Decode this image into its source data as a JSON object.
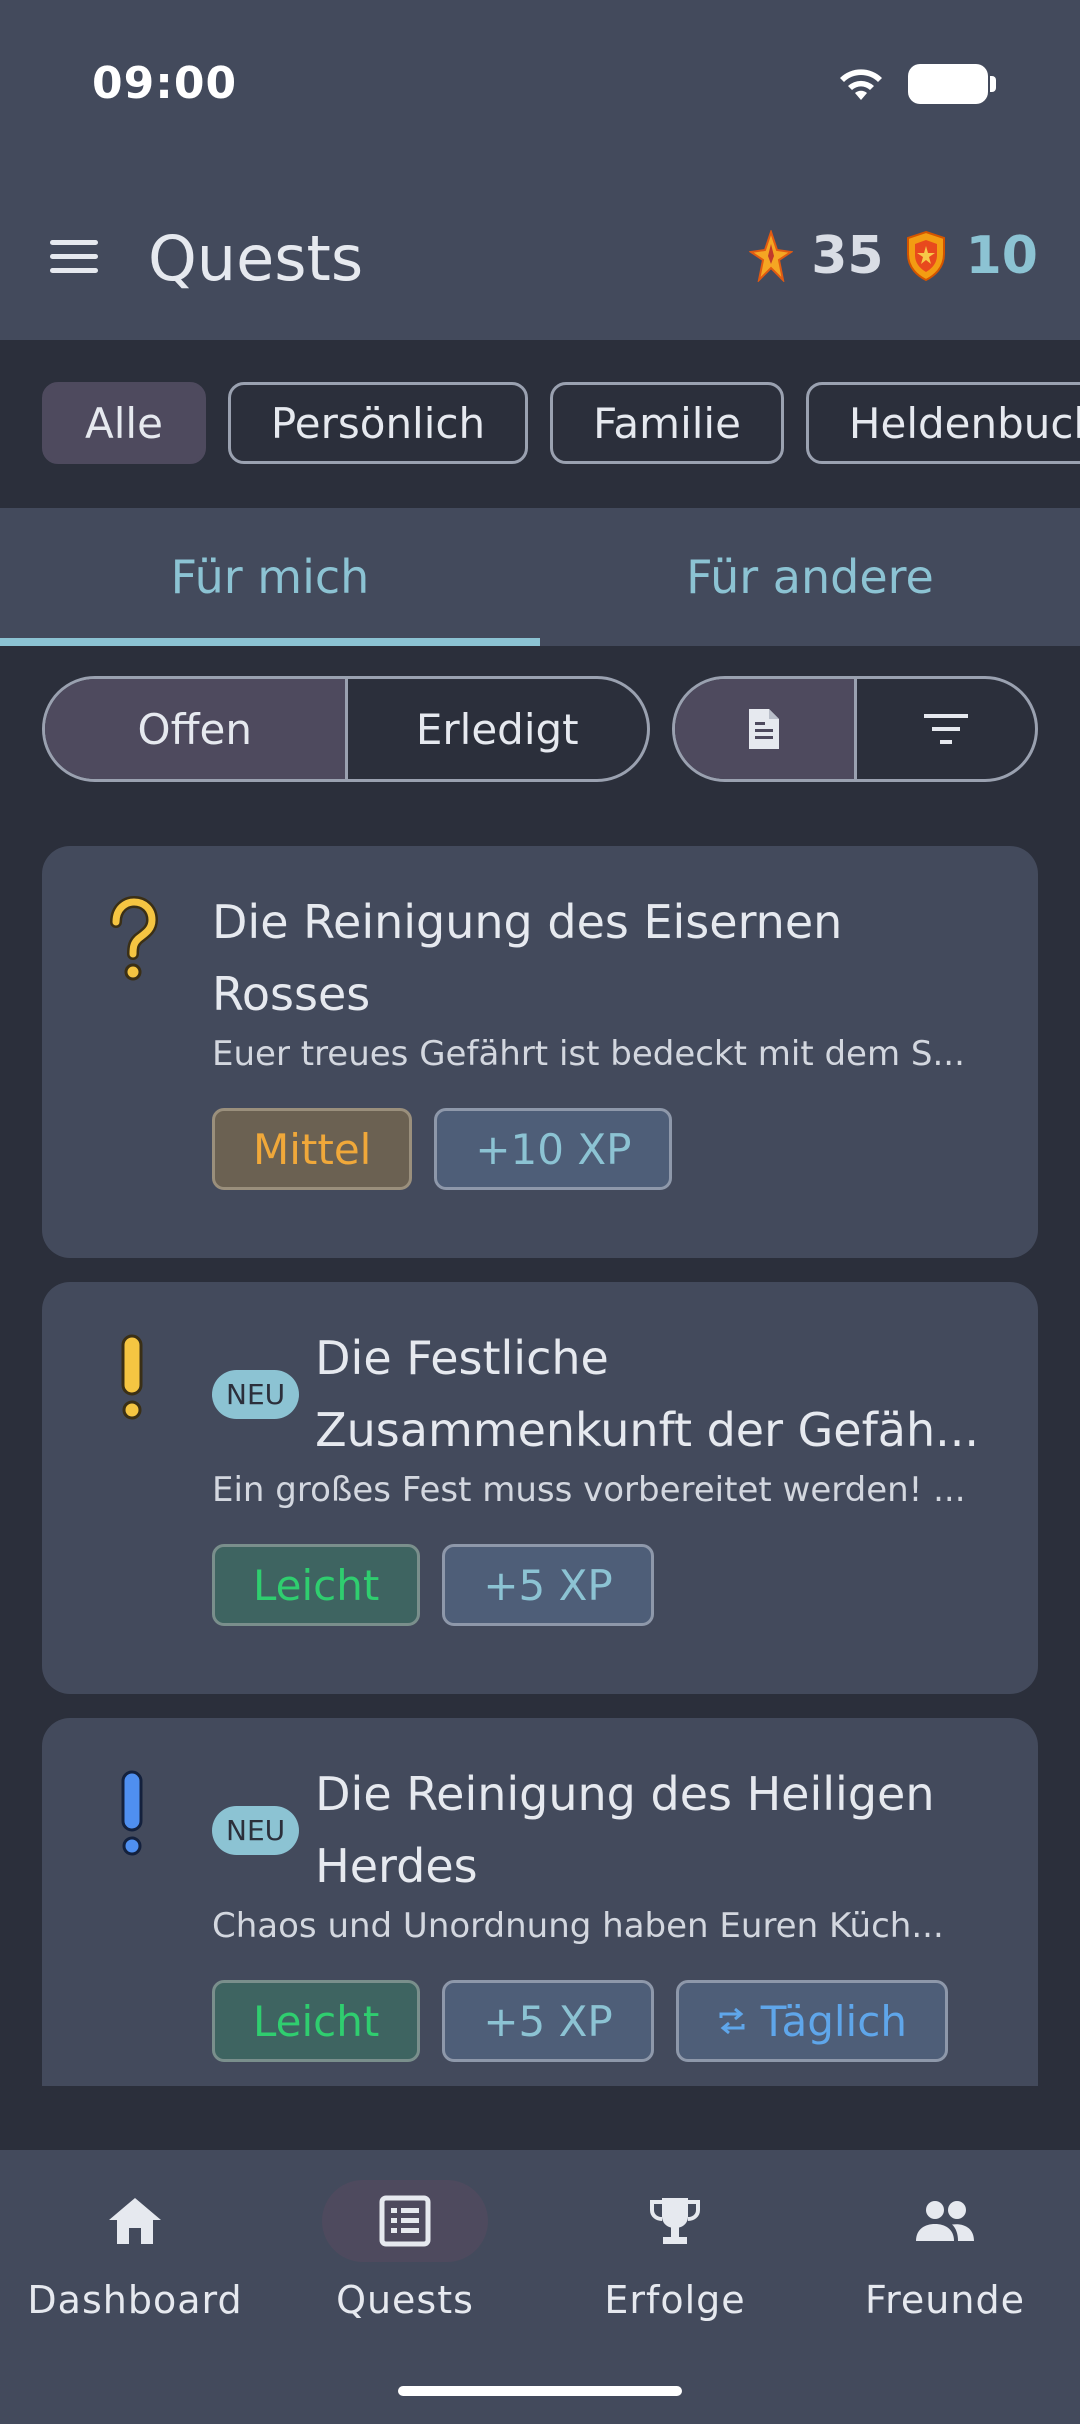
{
  "status_bar": {
    "time": "09:00"
  },
  "header": {
    "title": "Quests",
    "xp_value": "35",
    "shield_value": "10",
    "menu_icon": "hamburger-menu-icon",
    "xp_icon": "star-flame-icon",
    "shield_icon": "shield-icon"
  },
  "filters": {
    "chips": [
      {
        "label": "Alle",
        "active": true
      },
      {
        "label": "Persönlich",
        "active": false
      },
      {
        "label": "Familie",
        "active": false
      },
      {
        "label": "Heldenbuch",
        "active": false
      }
    ]
  },
  "tabs": [
    {
      "label": "Für mich",
      "active": true
    },
    {
      "label": "Für andere",
      "active": false
    }
  ],
  "status_segment": {
    "open": "Offen",
    "done": "Erledigt",
    "selected": "Offen"
  },
  "view_segment": {
    "list_icon": "document-icon",
    "sort_icon": "sort-icon"
  },
  "quests": [
    {
      "icon": "question-mark-icon",
      "new_badge": "",
      "title": "Die Reinigung des Eisernen Rosses",
      "description": "Euer treues Gefährt ist bedeckt mit dem S...",
      "difficulty": "Mittel",
      "xp": "+10 XP",
      "recurrence": ""
    },
    {
      "icon": "exclamation-yellow-icon",
      "new_badge": "NEU",
      "title": "Die Festliche Zusammenkunft der Gefäh...",
      "description": "Ein großes Fest muss vorbereitet werden! ...",
      "difficulty": "Leicht",
      "xp": "+5 XP",
      "recurrence": ""
    },
    {
      "icon": "exclamation-blue-icon",
      "new_badge": "NEU",
      "title": "Die Reinigung des Heiligen Herdes",
      "description": "Chaos und Unordnung haben Euren Küch...",
      "difficulty": "Leicht",
      "xp": "+5 XP",
      "recurrence": "Täglich"
    }
  ],
  "bottom_nav": [
    {
      "label": "Dashboard",
      "icon": "home-icon",
      "active": false
    },
    {
      "label": "Quests",
      "icon": "list-icon",
      "active": true
    },
    {
      "label": "Erfolge",
      "icon": "trophy-icon",
      "active": false
    },
    {
      "label": "Freunde",
      "icon": "people-icon",
      "active": false
    }
  ],
  "colors": {
    "background": "#2b2f3b",
    "surface": "#434a5c",
    "accent": "#8cc3d3",
    "medium": "#f0a83a",
    "easy": "#2fce6f",
    "daily": "#5fa6ea"
  }
}
